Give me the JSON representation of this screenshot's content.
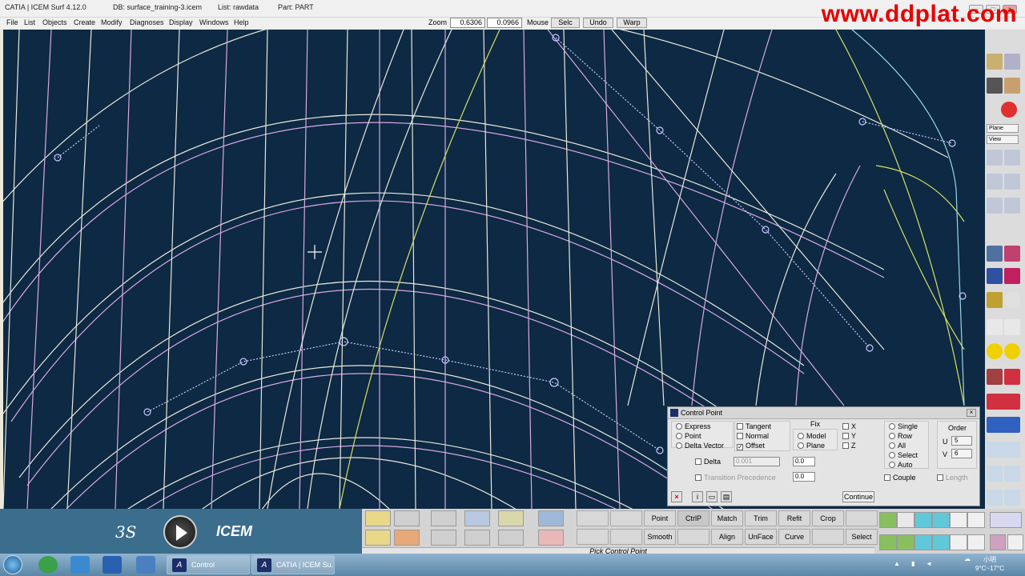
{
  "titlebar": {
    "app_title": "CATIA | ICEM Surf 4.12.0",
    "db": "DB: surface_training-3.icem",
    "list": "List: rawdata",
    "part": "Part: PART",
    "watermark": "www.ddplat.com"
  },
  "menu": [
    "File",
    "List",
    "Objects",
    "Create",
    "Modify",
    "Diagnoses",
    "Display",
    "Windows",
    "Help"
  ],
  "toolbar": {
    "zoom_label": "Zoom",
    "zoom_value": "0.6306",
    "zoom_value2": "0.0966",
    "mouse_label": "Mouse",
    "selc": "Selc",
    "undo": "Undo",
    "warp": "Warp"
  },
  "right_toolbar": {
    "plane": "Plane",
    "view": "View"
  },
  "dialog": {
    "title": "Control Point",
    "modes": [
      "Express",
      "Point",
      "Delta Vector"
    ],
    "direction": [
      {
        "label": "Tangent",
        "checked": false
      },
      {
        "label": "Normal",
        "checked": false
      },
      {
        "label": "Offset",
        "checked": true
      }
    ],
    "fix_label": "Fix",
    "fix_options": [
      "Model",
      "Plane"
    ],
    "axes": [
      "X",
      "Y",
      "Z"
    ],
    "scope": [
      "Single",
      "Row",
      "All",
      "Select",
      "Auto"
    ],
    "order_label": "Order",
    "order_u_label": "U",
    "order_u": "5",
    "order_v_label": "V",
    "order_v": "6",
    "delta_label": "Delta",
    "delta_value": "0.001",
    "offset_value": "0.0",
    "transition_label": "Transition Precedence",
    "transition_value": "0.0",
    "couple_label": "Couple",
    "length_label": "Length",
    "continue_label": "Continue"
  },
  "bottom": {
    "brand_ds": "3S",
    "brand_icem": "ICEM",
    "row1": [
      "Point",
      "CtrlP",
      "Match",
      "Trim",
      "Refit",
      "Crop"
    ],
    "row2": [
      "Smooth",
      "",
      "Align",
      "UnFace",
      "Curve",
      "",
      "Select"
    ],
    "status": "Pick Control Point"
  },
  "taskbar": {
    "tasks": [
      {
        "label": "Control"
      },
      {
        "label": "CATIA | ICEM Su..."
      }
    ],
    "tray_name": "小明",
    "tray_temp": "9°C~17°C"
  },
  "colors": {
    "viewport_bg": "#0d2944",
    "curve_white": "#e8e8d8",
    "curve_pink": "#d8a8e0",
    "curve_yellow": "#d8e060",
    "curve_cyan": "#9ad8e8"
  }
}
